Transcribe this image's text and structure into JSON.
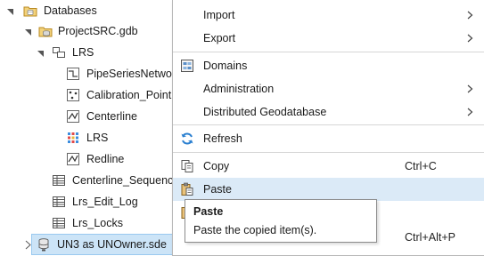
{
  "tree": {
    "databases": "Databases",
    "gdb": "ProjectSRC.gdb",
    "lrs_dataset": "LRS",
    "items": {
      "pipe": "PipeSeriesNetwork",
      "calib": "Calibration_Point",
      "center": "Centerline",
      "lrs": "LRS",
      "redline": "Redline",
      "centerseq": "Centerline_Sequence",
      "editlog": "Lrs_Edit_Log",
      "locks": "Lrs_Locks"
    },
    "connection": "UN3 as UNOwner.sde"
  },
  "menu": {
    "import": "Import",
    "export": "Export",
    "domains": "Domains",
    "administration": "Administration",
    "distributed": "Distributed Geodatabase",
    "refresh": "Refresh",
    "copy": "Copy",
    "copy_shortcut": "Ctrl+C",
    "paste": "Paste",
    "hidden_shortcut": "Ctrl+Alt+P"
  },
  "tooltip": {
    "title": "Paste",
    "description": "Paste the copied item(s)."
  },
  "colors": {
    "selection": "#cce4f7",
    "menu_highlight": "#dbeaf7",
    "refresh_icon": "#2a7fd0",
    "folder_icon": "#d9a441"
  }
}
